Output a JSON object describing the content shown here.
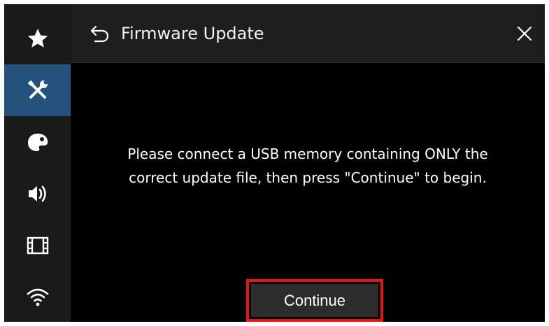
{
  "sidebar": {
    "items": [
      {
        "icon": "star-icon",
        "active": false
      },
      {
        "icon": "tools-icon",
        "active": true
      },
      {
        "icon": "palette-icon",
        "active": false
      },
      {
        "icon": "speaker-icon",
        "active": false
      },
      {
        "icon": "film-icon",
        "active": false
      },
      {
        "icon": "wifi-icon",
        "active": false
      }
    ]
  },
  "header": {
    "title": "Firmware Update",
    "back_icon": "back-arrow-icon",
    "close_icon": "close-icon"
  },
  "main": {
    "message_line1": "Please connect a USB memory containing  ONLY the",
    "message_line2": "correct update file, then press \"Continue\" to begin.",
    "continue_label": "Continue"
  },
  "colors": {
    "background": "#000000",
    "sidebar": "#1a1a1a",
    "header": "#1e1e1e",
    "active_item": "#24527d",
    "highlight": "#e8121a",
    "button": "#2c2c2c",
    "text": "#ffffff"
  }
}
